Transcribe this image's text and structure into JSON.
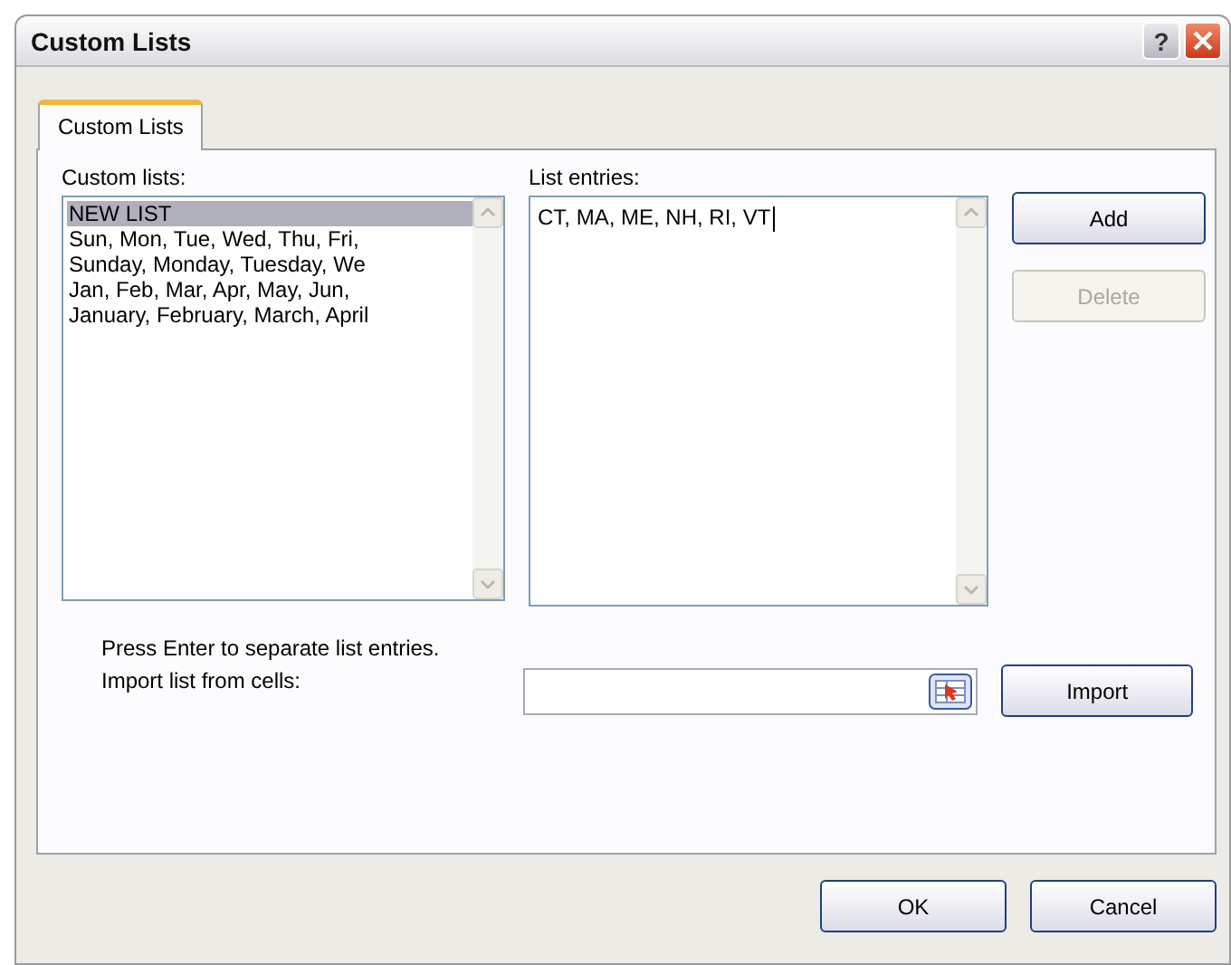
{
  "window": {
    "title": "Custom Lists",
    "controls": [
      "?"
    ]
  },
  "tabs": [
    {
      "label": "Custom Lists",
      "selected": true
    }
  ],
  "custom_lists": {
    "label": "Custom lists:",
    "items": [
      {
        "text": "NEW LIST",
        "selected": true
      },
      {
        "text": "Sun, Mon, Tue, Wed, Thu, Fri,",
        "selected": false
      },
      {
        "text": "Sunday, Monday, Tuesday, We",
        "selected": false
      },
      {
        "text": "Jan, Feb, Mar, Apr, May, Jun,",
        "selected": false
      },
      {
        "text": "January, February, March, April",
        "selected": false
      }
    ]
  },
  "list_entries": {
    "label": "List entries:",
    "value": "CT, MA, ME, NH, RI, VT"
  },
  "side_buttons": [
    {
      "label": "Add",
      "disabled": false
    },
    {
      "label": "Delete",
      "disabled": true
    }
  ],
  "hint": "Press Enter to separate list entries.",
  "import": {
    "label": "Import list from cells:",
    "button": "Import"
  },
  "footer_buttons": [
    "OK",
    "Cancel"
  ]
}
